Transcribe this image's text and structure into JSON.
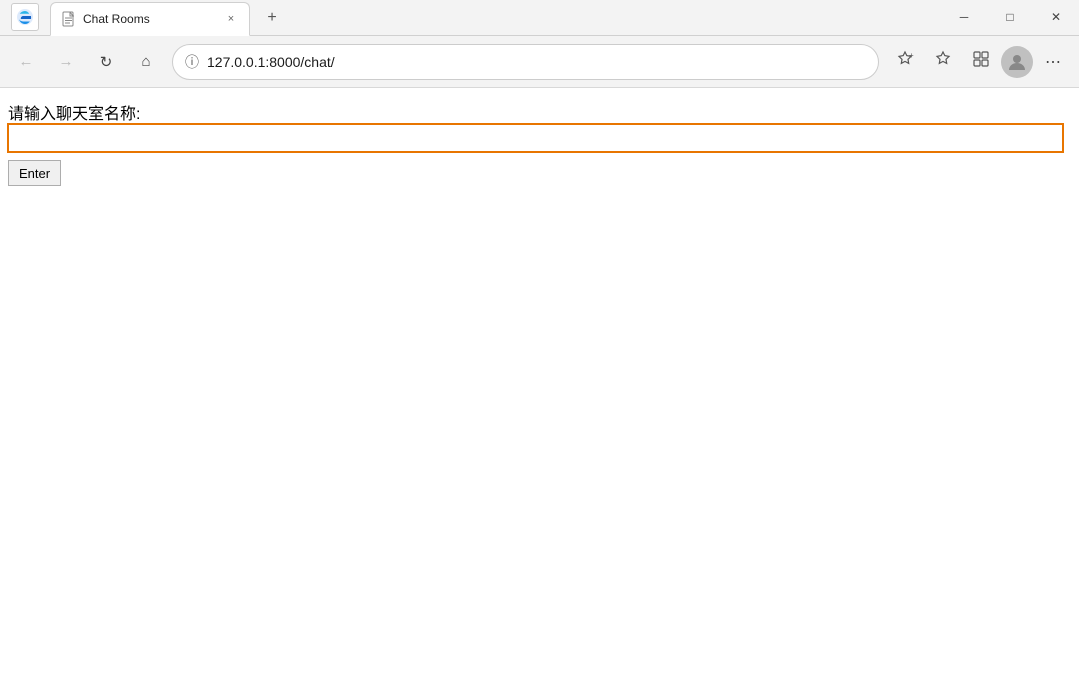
{
  "browser": {
    "tab": {
      "title": "Chat Rooms",
      "favicon": "📄",
      "close_label": "×"
    },
    "new_tab_label": "+",
    "window_controls": {
      "minimize": "─",
      "maximize": "□",
      "close": "✕"
    },
    "nav": {
      "back_label": "←",
      "forward_label": "→",
      "refresh_label": "↺",
      "home_label": "⌂"
    },
    "address": "127.0.0.1:8000/chat/",
    "toolbar_icons": {
      "add_favorites": "☆+",
      "favorites": "☆",
      "collections": "⧉",
      "more": "…"
    }
  },
  "page": {
    "label": "请输入聊天室名称:",
    "input_placeholder": "",
    "enter_button": "Enter"
  },
  "colors": {
    "accent": "#e87500",
    "border": "#000000",
    "tab_bg": "#ffffff",
    "chrome_bg": "#f3f3f3"
  }
}
